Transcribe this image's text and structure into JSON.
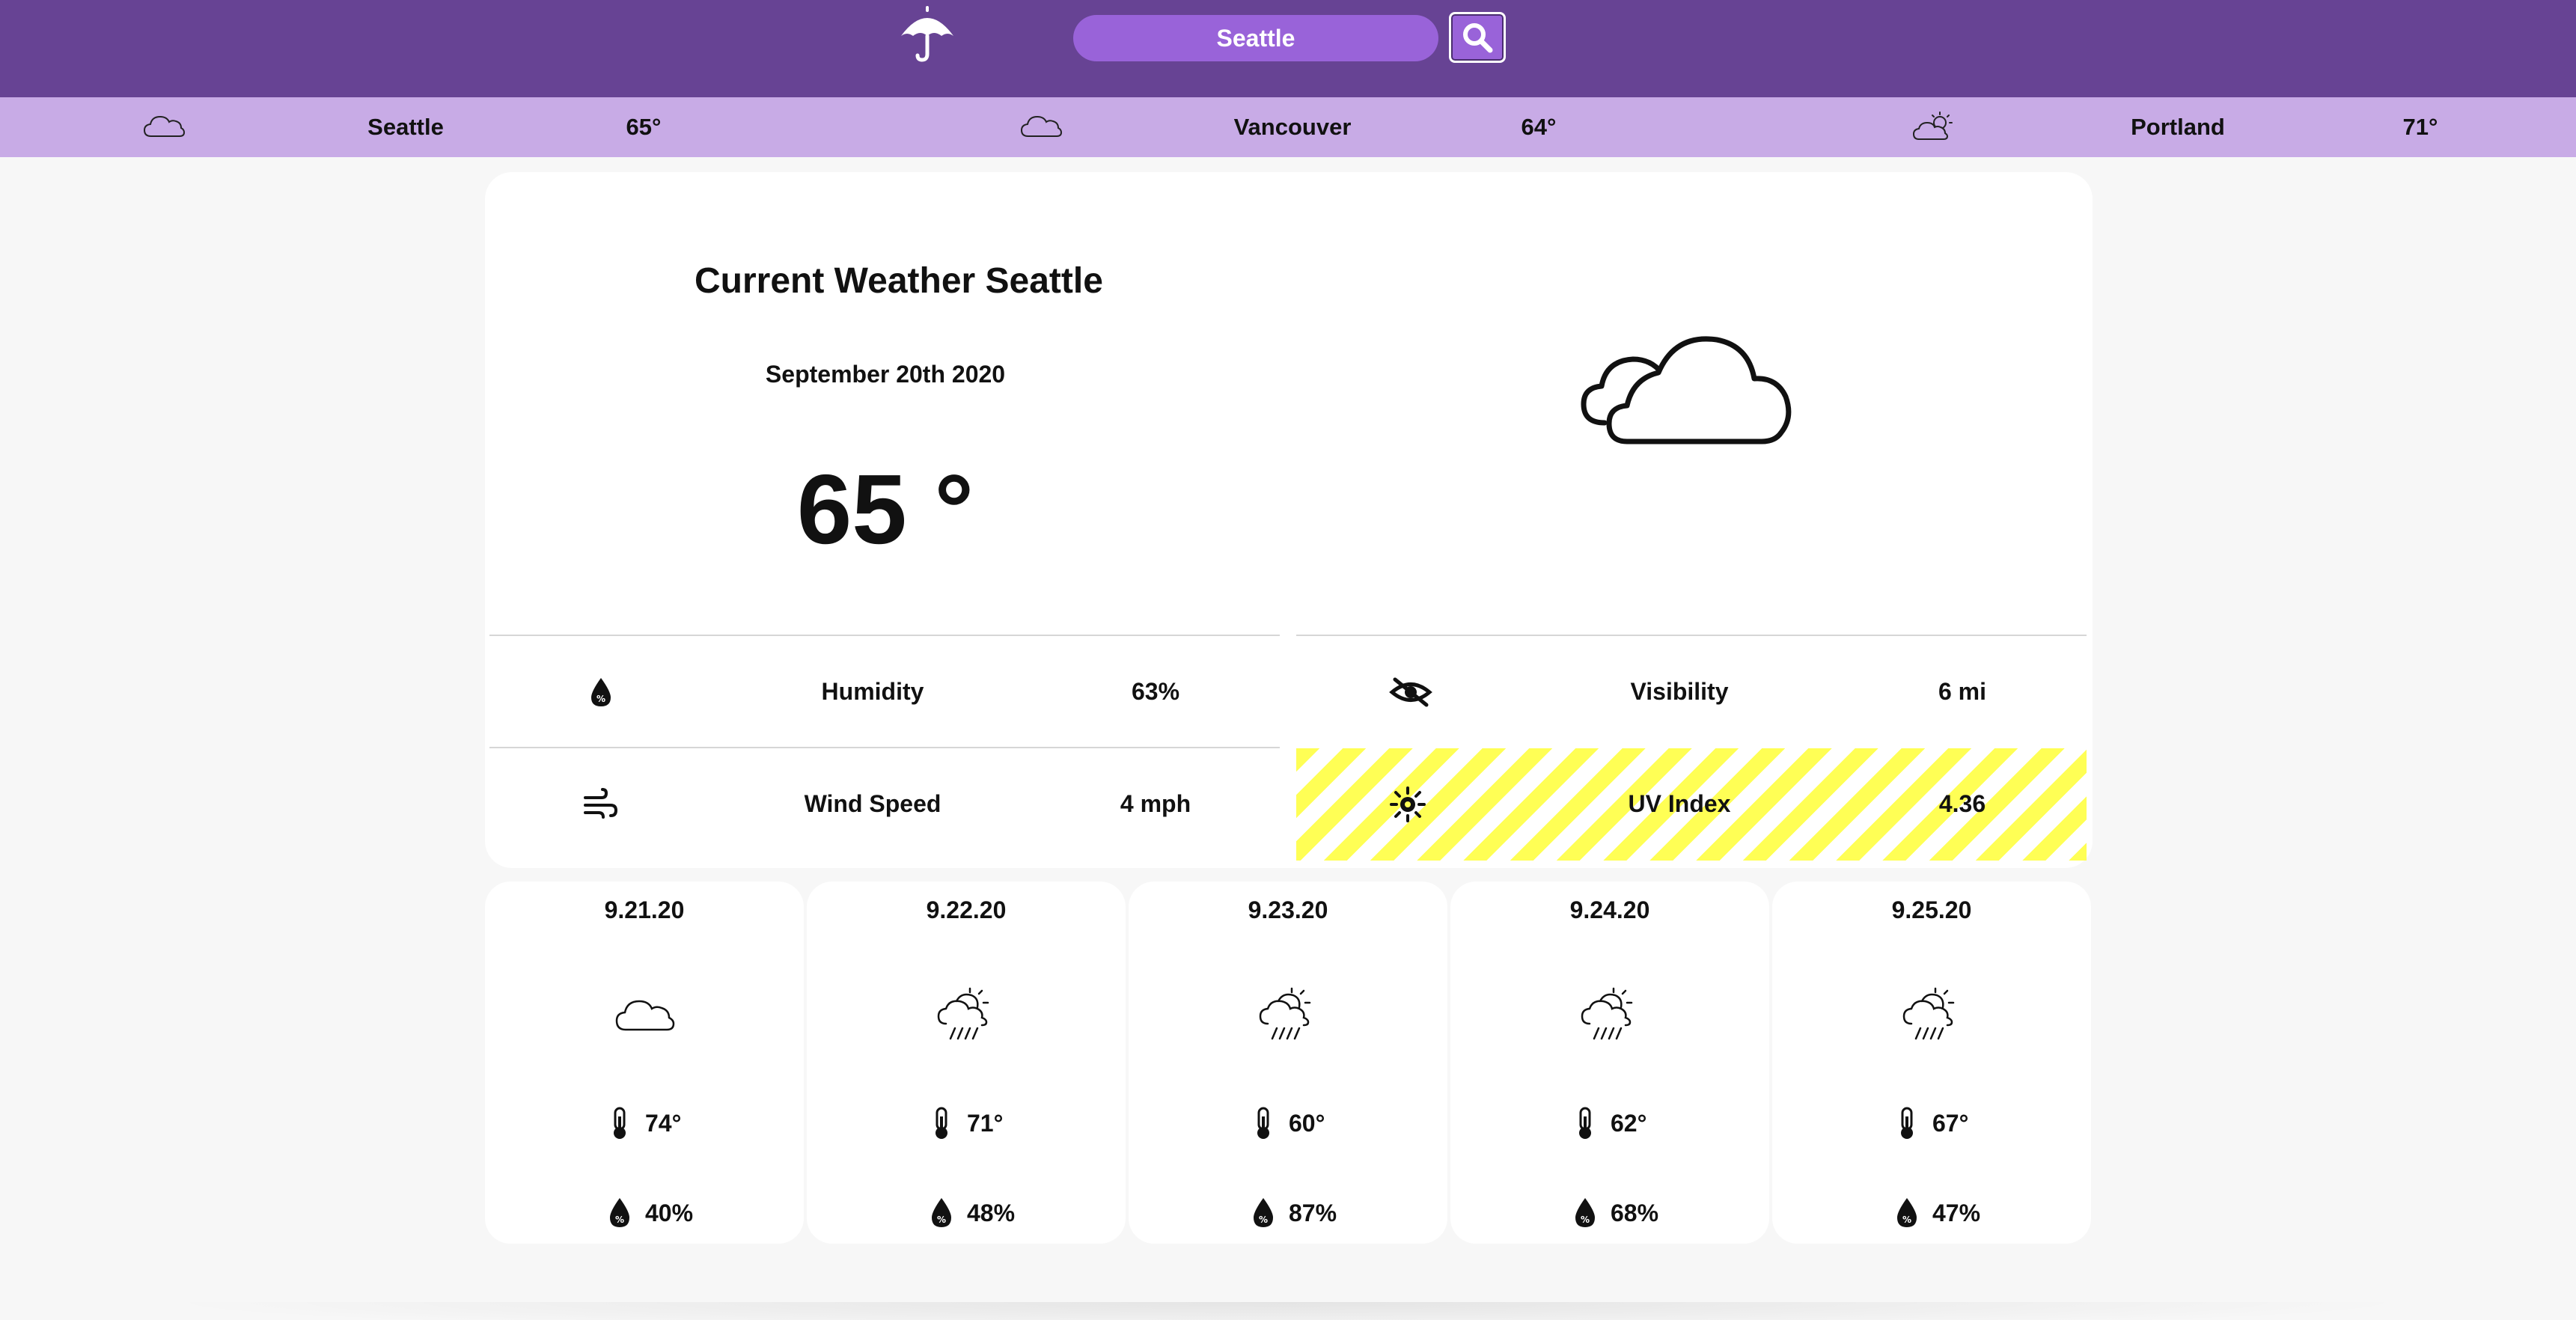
{
  "header": {
    "logo_icon": "umbrella-icon",
    "search": {
      "value": "Seattle"
    },
    "search_button_icon": "search-icon",
    "colors": {
      "bar": "#674394",
      "search": "#9963d9",
      "strip": "#c8abe6"
    }
  },
  "cities": [
    {
      "name": "Seattle",
      "temp": "65°",
      "icon": "cloud-icon"
    },
    {
      "name": "Vancouver",
      "temp": "64°",
      "icon": "cloud-icon"
    },
    {
      "name": "Portland",
      "temp": "71°",
      "icon": "partly-cloudy-icon"
    }
  ],
  "current": {
    "title": "Current Weather Seattle",
    "date": "September 20th 2020",
    "temp": "65 °",
    "icon": "cloudy-icon"
  },
  "stats": {
    "humidity": {
      "label": "Humidity",
      "value": "63%",
      "icon": "humidity-drop-icon"
    },
    "visibility": {
      "label": "Visibility",
      "value": "6 mi",
      "icon": "eye-slash-icon"
    },
    "wind": {
      "label": "Wind Speed",
      "value": "4 mph",
      "icon": "wind-icon"
    },
    "uv": {
      "label": "UV Index",
      "value": "4.36",
      "icon": "sun-icon",
      "highlight_color": "#ffff55"
    }
  },
  "forecast": [
    {
      "date": "9.21.20",
      "icon": "cloud-icon",
      "temp": "74°",
      "humidity": "40%"
    },
    {
      "date": "9.22.20",
      "icon": "rain-sun-icon",
      "temp": "71°",
      "humidity": "48%"
    },
    {
      "date": "9.23.20",
      "icon": "rain-sun-icon",
      "temp": "60°",
      "humidity": "87%"
    },
    {
      "date": "9.24.20",
      "icon": "rain-sun-icon",
      "temp": "62°",
      "humidity": "68%"
    },
    {
      "date": "9.25.20",
      "icon": "rain-sun-icon",
      "temp": "67°",
      "humidity": "47%"
    }
  ]
}
